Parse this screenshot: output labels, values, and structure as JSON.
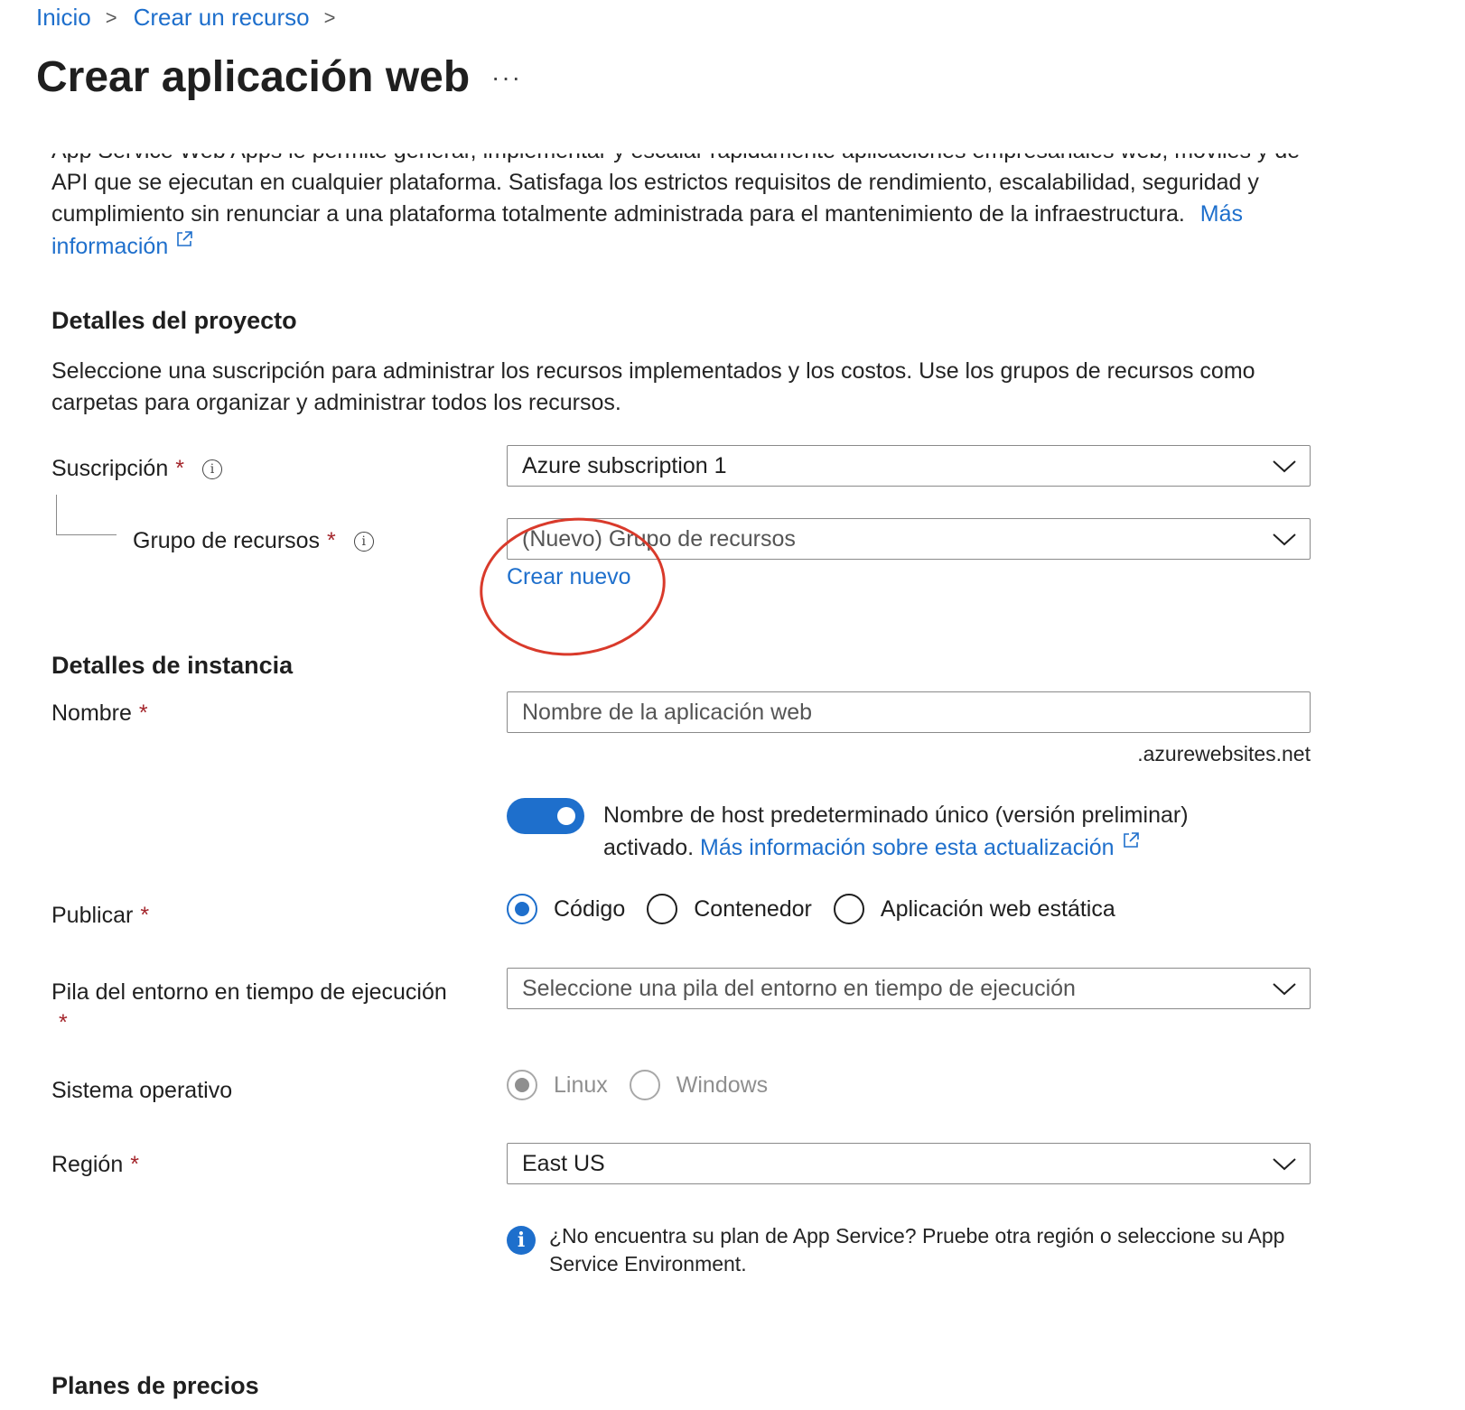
{
  "breadcrumb": {
    "home": "Inicio",
    "create_resource": "Crear un recurso",
    "sep": ">"
  },
  "page": {
    "title": "Crear aplicación web",
    "more": "···"
  },
  "intro": {
    "text": "App Service Web Apps le permite generar, implementar y escalar rápidamente aplicaciones empresariales web, móviles y de API que se ejecutan en cualquier plataforma. Satisfaga los estrictos requisitos de rendimiento, escalabilidad, seguridad y cumplimiento sin renunciar a una plataforma totalmente administrada para el mantenimiento de la infraestructura.",
    "link": "Más información"
  },
  "project": {
    "heading": "Detalles del proyecto",
    "description": "Seleccione una suscripción para administrar los recursos implementados y los costos. Use los grupos de recursos como carpetas para organizar y administrar todos los recursos.",
    "subscription_label": "Suscripción",
    "subscription_value": "Azure subscription 1",
    "resource_group_label": "Grupo de recursos",
    "resource_group_value": "(Nuevo) Grupo de recursos",
    "create_new": "Crear nuevo"
  },
  "instance": {
    "heading": "Detalles de instancia",
    "name_label": "Nombre",
    "name_placeholder": "Nombre de la aplicación web",
    "domain_suffix": ".azurewebsites.net",
    "toggle_text": "Nombre de host predeterminado único (versión preliminar) activado.",
    "toggle_link": "Más información sobre esta actualización",
    "toggle_on": true,
    "publish_label": "Publicar",
    "publish_options": [
      "Código",
      "Contenedor",
      "Aplicación web estática"
    ],
    "publish_selected": "Código",
    "runtime_label": "Pila del entorno en tiempo de ejecución",
    "runtime_placeholder": "Seleccione una pila del entorno en tiempo de ejecución",
    "os_label": "Sistema operativo",
    "os_options": [
      "Linux",
      "Windows"
    ],
    "os_selected": "Linux",
    "region_label": "Región",
    "region_value": "East US",
    "info_message": "¿No encuentra su plan de App Service? Pruebe otra región o seleccione su App Service Environment."
  },
  "pricing": {
    "heading": "Planes de precios"
  },
  "required_mark": "*",
  "colors": {
    "accent": "#1e6fcc",
    "required": "#a4262c",
    "annotation": "#d93a2b"
  }
}
